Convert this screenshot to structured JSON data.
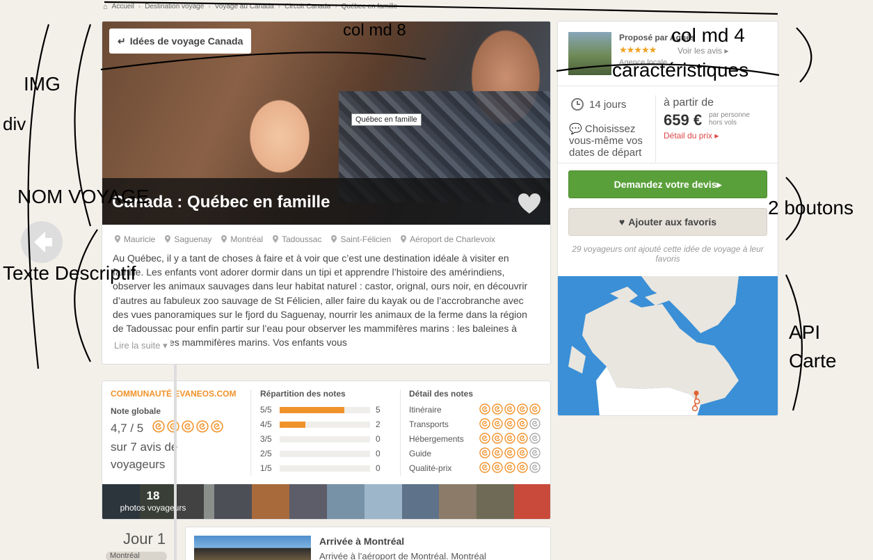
{
  "breadcrumb": [
    "Accueil",
    "Destination voyage",
    "Voyage au Canada",
    "Circuit Canada",
    "Québec en famille"
  ],
  "hero": {
    "back_label": "Idées de voyage Canada",
    "tooltip": "Québec en famille",
    "title": "Canada : Québec en famille"
  },
  "places": [
    "Mauricie",
    "Saguenay",
    "Montréal",
    "Tadoussac",
    "Saint-Félicien",
    "Aéroport de Charlevoix"
  ],
  "description": "Au Québec, il y a tant de choses à faire et à voir que c’est une destination idéale à visiter en famille. Les enfants vont adorer dormir dans un tipi et apprendre l’histoire des amérindiens, observer les animaux sauvages dans leur habitat naturel : castor, orignal, ours noir, en découvrir d’autres au fabuleux zoo sauvage de St Félicien, aller faire du kayak ou de l’accrobranche avec des vues panoramiques sur le fjord du Saguenay, nourrir les animaux de la ferme dans la région de Tadoussac pour enfin partir sur l’eau pour observer les mammifères marins : les baleines à bosse et autres mammifères marins. Vos enfants vous",
  "read_more": "Lire la suite",
  "sidebar": {
    "proposed_by": "Proposé par Agnès",
    "stars": "★★★★★",
    "rating": 4.5,
    "see_reviews": "Voir les avis",
    "agency": "Agence locale",
    "duration": "14 jours",
    "departure": "Choisissez vous-même vos dates de départ",
    "from": "à partir de",
    "price": "659 €",
    "per_person": "par personne hors vols",
    "price_detail": "Détail du prix",
    "quote_button": "Demandez votre devis",
    "fav_button": "Ajouter aux favoris",
    "fav_note": "29 voyageurs ont ajouté cette idée de voyage à leur favoris"
  },
  "reviews": {
    "community": "COMMUNAUTÉ EVANEOS.COM",
    "global_label": "Note globale",
    "global_value": "4,7 / 5",
    "global_score": 4.7,
    "global_sub": "sur 7 avis de voyageurs",
    "distribution_title": "Répartition des notes",
    "distribution": [
      {
        "label": "5/5",
        "count": "5",
        "fraction": 0.714
      },
      {
        "label": "4/5",
        "count": "2",
        "fraction": 0.286
      },
      {
        "label": "3/5",
        "count": "0",
        "fraction": 0
      },
      {
        "label": "2/5",
        "count": "0",
        "fraction": 0
      },
      {
        "label": "1/5",
        "count": "0",
        "fraction": 0
      }
    ],
    "detail_title": "Détail des notes",
    "details": [
      {
        "label": "Itinéraire",
        "score": 5
      },
      {
        "label": "Transports",
        "score": 4
      },
      {
        "label": "Hébergements",
        "score": 4
      },
      {
        "label": "Guide",
        "score": 4
      },
      {
        "label": "Qualité-prix",
        "score": 4
      }
    ],
    "photo_count": "18",
    "photo_label": "photos voyageurs"
  },
  "day1": {
    "day": "Jour 1",
    "tag": "Montréal",
    "title": "Arrivée à Montréal",
    "text": "Arrivée à l’aéroport de Montréal. Montréal"
  },
  "annotations": {
    "col8": "col md 8",
    "col4": "col md 4",
    "caracteristiques": "caractéristiques",
    "img": "IMG",
    "div": "div",
    "nom_voyage": "NOM VOYAGE",
    "texte": "Texte Descriptif",
    "boutons": "2 boutons",
    "api": "API",
    "carte": "Carte"
  },
  "colors": {
    "accent": "#f0922a",
    "cta_green": "#5aa03a",
    "link_red": "#d44444"
  }
}
